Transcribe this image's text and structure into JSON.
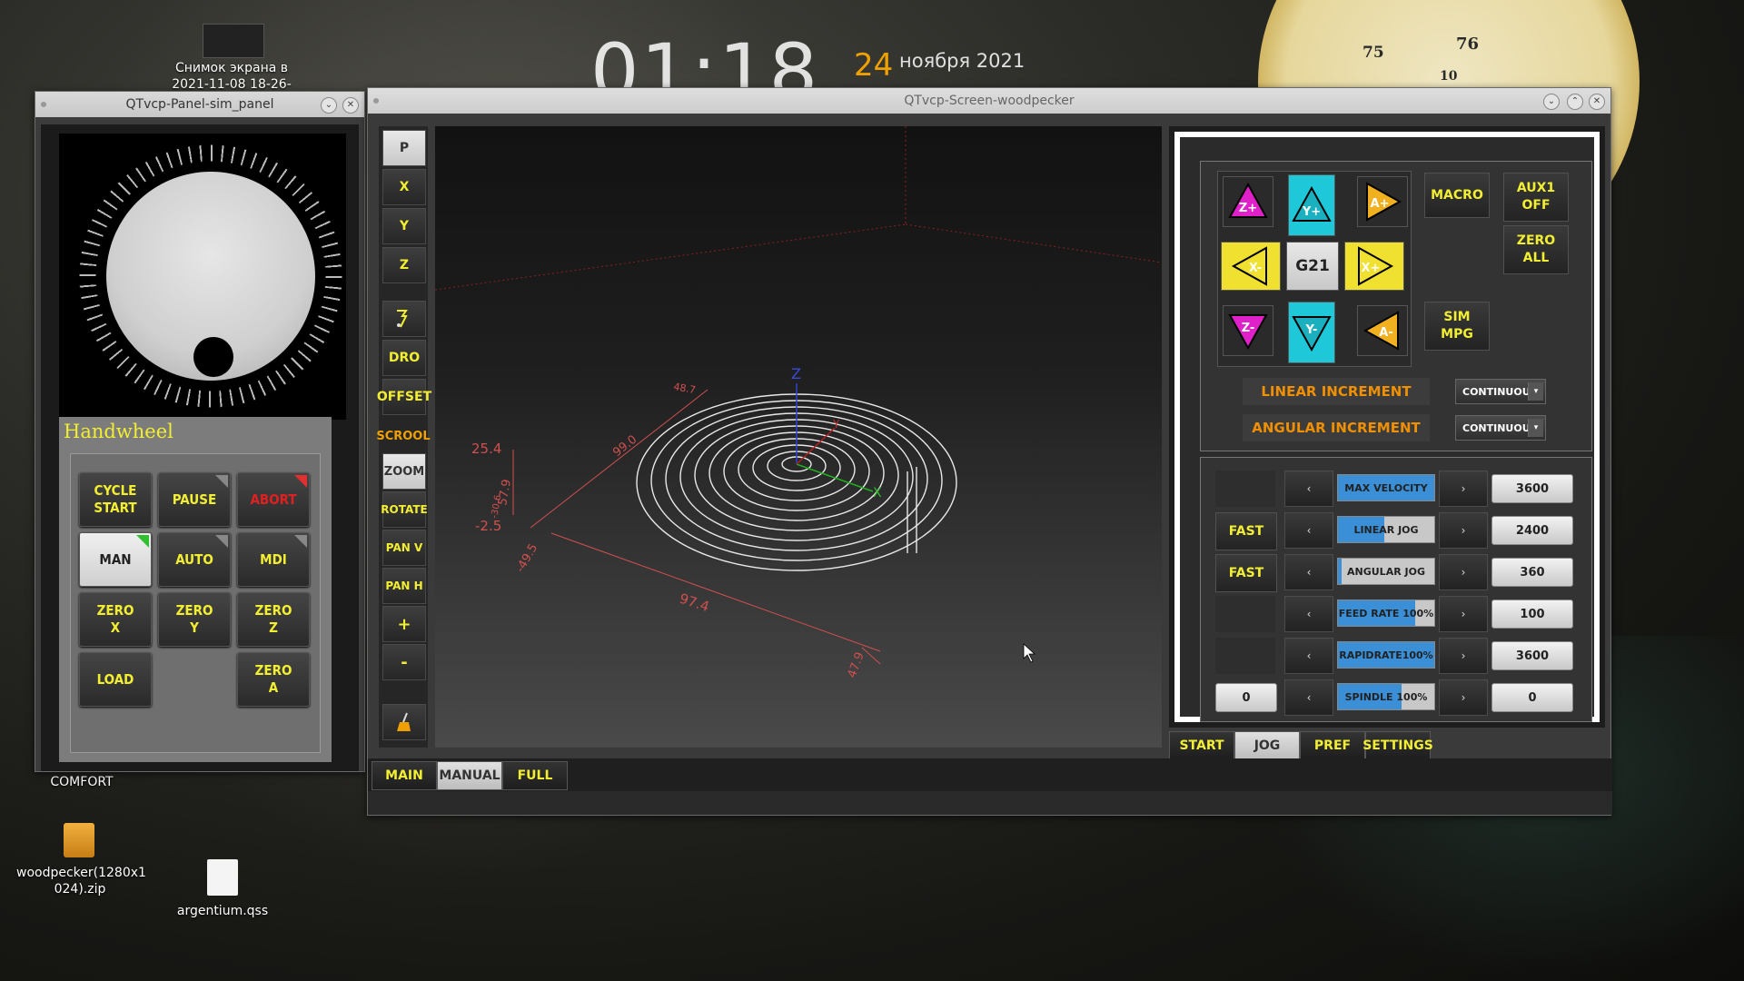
{
  "desktop": {
    "clock_time": "01:18",
    "clock_day": "24",
    "clock_month": "ноября 2021",
    "icons": [
      {
        "label": "Снимок экрана в\n2021-11-08 18-26-"
      },
      {
        "label": "COMFORT"
      },
      {
        "label": "woodpecker(1280x1\n024).zip"
      },
      {
        "label": "argentium.qss"
      }
    ],
    "gauge_labels": [
      "75",
      "76",
      "10"
    ]
  },
  "sim_panel": {
    "title": "QTvcp-Panel-sim_panel",
    "handwheel_title": "Handwheel",
    "buttons": [
      {
        "label": "CYCLE\nSTART"
      },
      {
        "label": "PAUSE"
      },
      {
        "label": "ABORT"
      },
      {
        "label": "MAN"
      },
      {
        "label": "AUTO"
      },
      {
        "label": "MDI"
      },
      {
        "label": "ZERO\nX"
      },
      {
        "label": "ZERO\nY"
      },
      {
        "label": "ZERO\nZ"
      },
      {
        "label": "LOAD"
      },
      {
        "label": "ZERO\nA"
      }
    ]
  },
  "main_window": {
    "title": "QTvcp-Screen-woodpecker",
    "side_buttons": [
      "P",
      "X",
      "Y",
      "Z",
      "DRO",
      "OFFSET",
      "SCROOL",
      "ZOOM",
      "ROTATE",
      "PAN V",
      "PAN H",
      "+",
      "-"
    ],
    "graphics": {
      "axis_labels": [
        "Z",
        "X",
        "Y"
      ],
      "dims": [
        "48.7",
        "99.0",
        "25.4",
        "57.9",
        "-30.6",
        "-2.5",
        "-49.5",
        "97.4",
        "47.9"
      ]
    },
    "jog": {
      "buttons": [
        "Z+",
        "Y+",
        "A+",
        "X-",
        "G21",
        "X+",
        "Z-",
        "Y-",
        "A-"
      ],
      "macro": "MACRO",
      "aux": "AUX1\nOFF",
      "zero_all": "ZERO\nALL",
      "sim_mpg": "SIM\nMPG",
      "linear_increment": "LINEAR INCREMENT",
      "angular_increment": "ANGULAR INCREMENT",
      "linear_increment_value": "CONTINUOUS",
      "angular_increment_value": "CONTINUOUS"
    },
    "rates": [
      {
        "left": "",
        "label": "MAX VELOCITY",
        "value": "3600",
        "fill": 1.0
      },
      {
        "left": "FAST",
        "label": "LINEAR JOG",
        "value": "2400",
        "fill": 0.48
      },
      {
        "left": "FAST",
        "label": "ANGULAR JOG",
        "value": "360",
        "fill": 0.04
      },
      {
        "left": "",
        "label": "FEED RATE 100%",
        "value": "100",
        "fill": 0.8
      },
      {
        "left": "",
        "label": "RAPIDRATE100%",
        "value": "3600",
        "fill": 1.0
      },
      {
        "left": "0",
        "label": "SPINDLE  100%",
        "value": "0",
        "fill": 0.66
      }
    ],
    "right_tabs": [
      "START",
      "JOG",
      "PREF",
      "SETTINGS"
    ],
    "active_right_tab": "JOG",
    "bottom_tabs": [
      "MAIN",
      "MANUAL",
      "FULL"
    ],
    "active_bottom_tab": "MANUAL"
  },
  "colors": {
    "accent_yellow": "#f2ee32",
    "orange": "#f09000",
    "magenta": "#e020c8",
    "cyan": "#1fc8d8",
    "jog_yellow": "#f0e030"
  }
}
